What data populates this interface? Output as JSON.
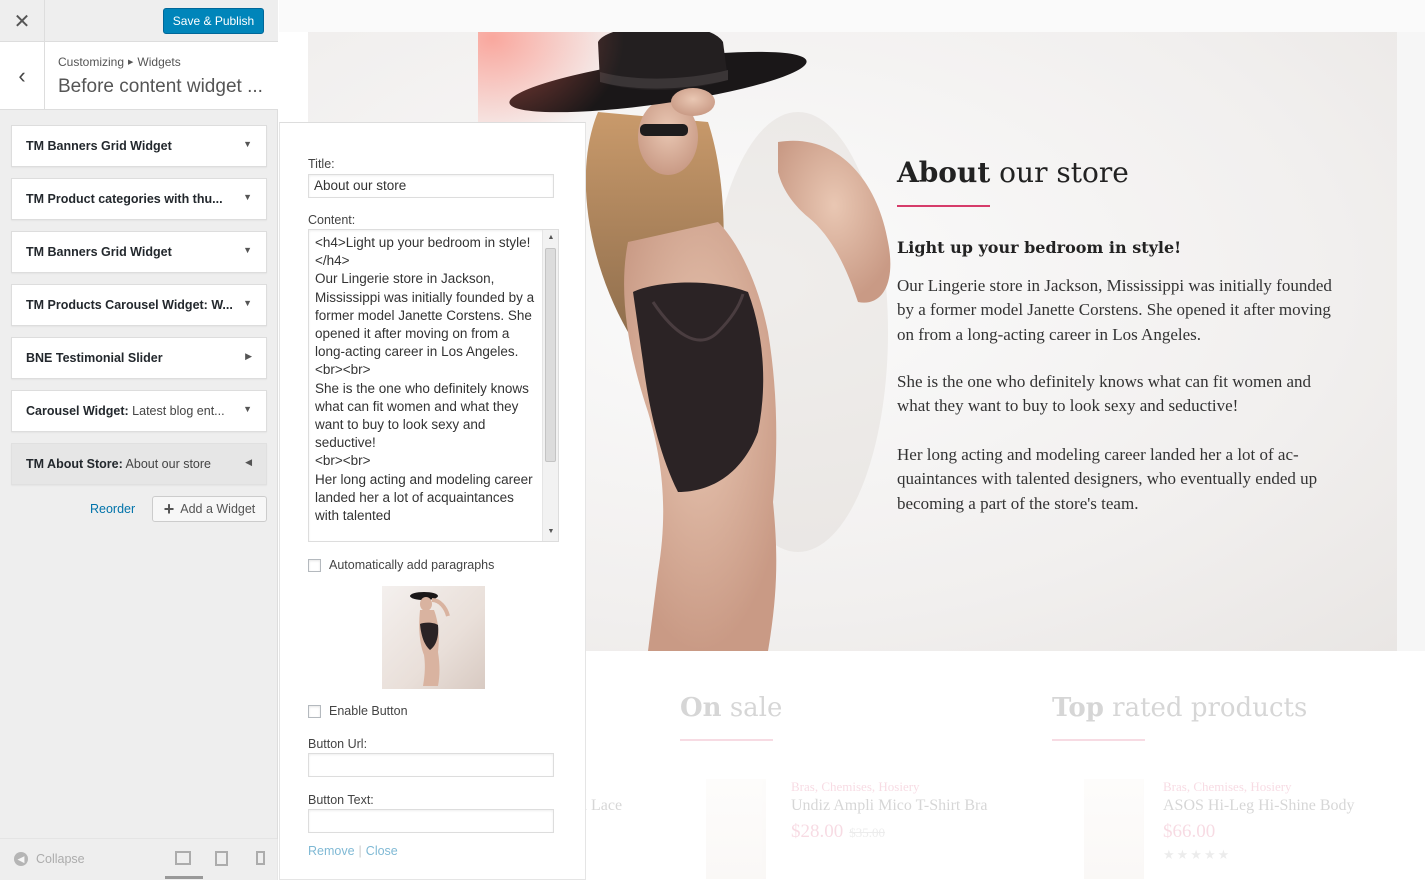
{
  "header": {
    "close_icon": "close-icon",
    "save_label": "Save & Publish"
  },
  "section": {
    "breadcrumb_root": "Customizing",
    "breadcrumb_current": "Widgets",
    "title": "Before content widget ...",
    "back_icon": "chevron-left-icon"
  },
  "widgets": [
    {
      "title": "TM Banners Grid Widget",
      "suffix": "",
      "arrow": "▼"
    },
    {
      "title": "TM Product categories with thu...",
      "suffix": "",
      "arrow": "▼"
    },
    {
      "title": "TM Banners Grid Widget",
      "suffix": "",
      "arrow": "▼"
    },
    {
      "title": "TM Products Carousel Widget: W...",
      "suffix": "",
      "arrow": "▼"
    },
    {
      "title": "BNE Testimonial Slider",
      "suffix": "",
      "arrow": "▶"
    },
    {
      "title": "Carousel Widget:",
      "suffix": " Latest blog ent...",
      "arrow": "▼"
    },
    {
      "title": "TM About Store:",
      "suffix": " About our store",
      "arrow": "◀"
    }
  ],
  "actions": {
    "reorder": "Reorder",
    "add_widget": "Add a Widget"
  },
  "footer": {
    "collapse": "Collapse"
  },
  "form": {
    "title_label": "Title:",
    "title_value": "About our store",
    "content_label": "Content:",
    "content_value": "<h4>Light up your bedroom in style!</h4>\nOur Lingerie store in Jackson, Mississippi was initially founded by a former model Janette Corstens. She opened it after moving on from a long-acting career in Los Angeles.\n<br><br>\nShe is the one who definitely knows what can fit women and what they want to buy to look sexy and seductive!\n<br><br>\nHer long acting and modeling career landed her a lot of acquaintances with talented",
    "auto_paragraphs": "Automatically add paragraphs",
    "enable_button": "Enable Button",
    "button_url_label": "Button Url:",
    "button_url_value": "",
    "button_text_label": "Button Text:",
    "button_text_value": "",
    "remove": "Remove",
    "separator": "|",
    "close": "Close"
  },
  "preview": {
    "about_title_bold": "About",
    "about_title_rest": " our store",
    "subtitle": "Light up your bedroom in style!",
    "paragraphs": [
      "Our Lingerie store in Jackson, Mississippi was initially founded by a former model Janette Corstens. She opened it after moving on from a long-acting career in Los Angeles.",
      "She is the one who definitely knows what can fit women and what they want to buy to look sexy and seductive!",
      "Her long acting and modeling career landed her a lot of ac-quaintances with talented designers, who eventually ended up becoming a part of the store's team."
    ],
    "accent_color": "#d63c6a",
    "on_sale_bold": "On",
    "on_sale_rest": " sale",
    "top_rated_bold": "Top",
    "top_rated_rest": " rated products",
    "partial_text": "d Lace",
    "products": [
      {
        "category": "Bras, Chemises, Hosiery",
        "name": "Undiz Ampli Mico T-Shirt Bra",
        "price": "$28.00",
        "old_price": "$35.00"
      },
      {
        "category": "Bras, Chemises, Hosiery",
        "name": "ASOS Hi-Leg Hi-Shine Body",
        "price": "$66.00",
        "rating": "★★★★★"
      }
    ]
  }
}
